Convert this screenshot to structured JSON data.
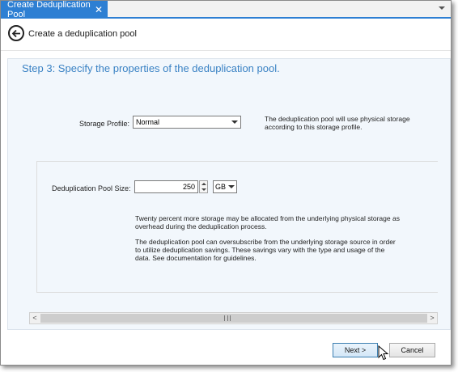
{
  "tab": {
    "title": "Create Deduplication Pool",
    "close_glyph": "✕"
  },
  "header": {
    "title": "Create a deduplication pool"
  },
  "step": {
    "title": "Step 3:  Specify the properties of the deduplication pool."
  },
  "storage_profile": {
    "label": "Storage Profile:",
    "value": "Normal",
    "description_line1": "The deduplication pool will use physical storage",
    "description_line2": "according to this storage profile."
  },
  "pool_size": {
    "label": "Deduplication Pool Size:",
    "value": "250",
    "unit": "GB",
    "note1_line1": "Twenty percent more storage may be allocated from the underlying physical storage as",
    "note1_line2": "overhead during the deduplication process.",
    "note2_line1": "The deduplication pool can oversubscribe from the underlying storage source in order",
    "note2_line2": "to utilize deduplication savings. These savings vary with the type and usage of the",
    "note2_line3": "data.  See documentation for guidelines."
  },
  "scrollbar": {
    "left_glyph": "<",
    "right_glyph": ">"
  },
  "buttons": {
    "next": "Next >",
    "cancel": "Cancel"
  },
  "icons": {
    "back": "back-arrow-icon",
    "dropdown": "chevron-down-icon",
    "tab_menu": "dropdown-arrow-icon"
  },
  "colors": {
    "accent": "#2d7fd3",
    "step_title": "#3a82c4",
    "content_bg": "#f2f7fc"
  }
}
